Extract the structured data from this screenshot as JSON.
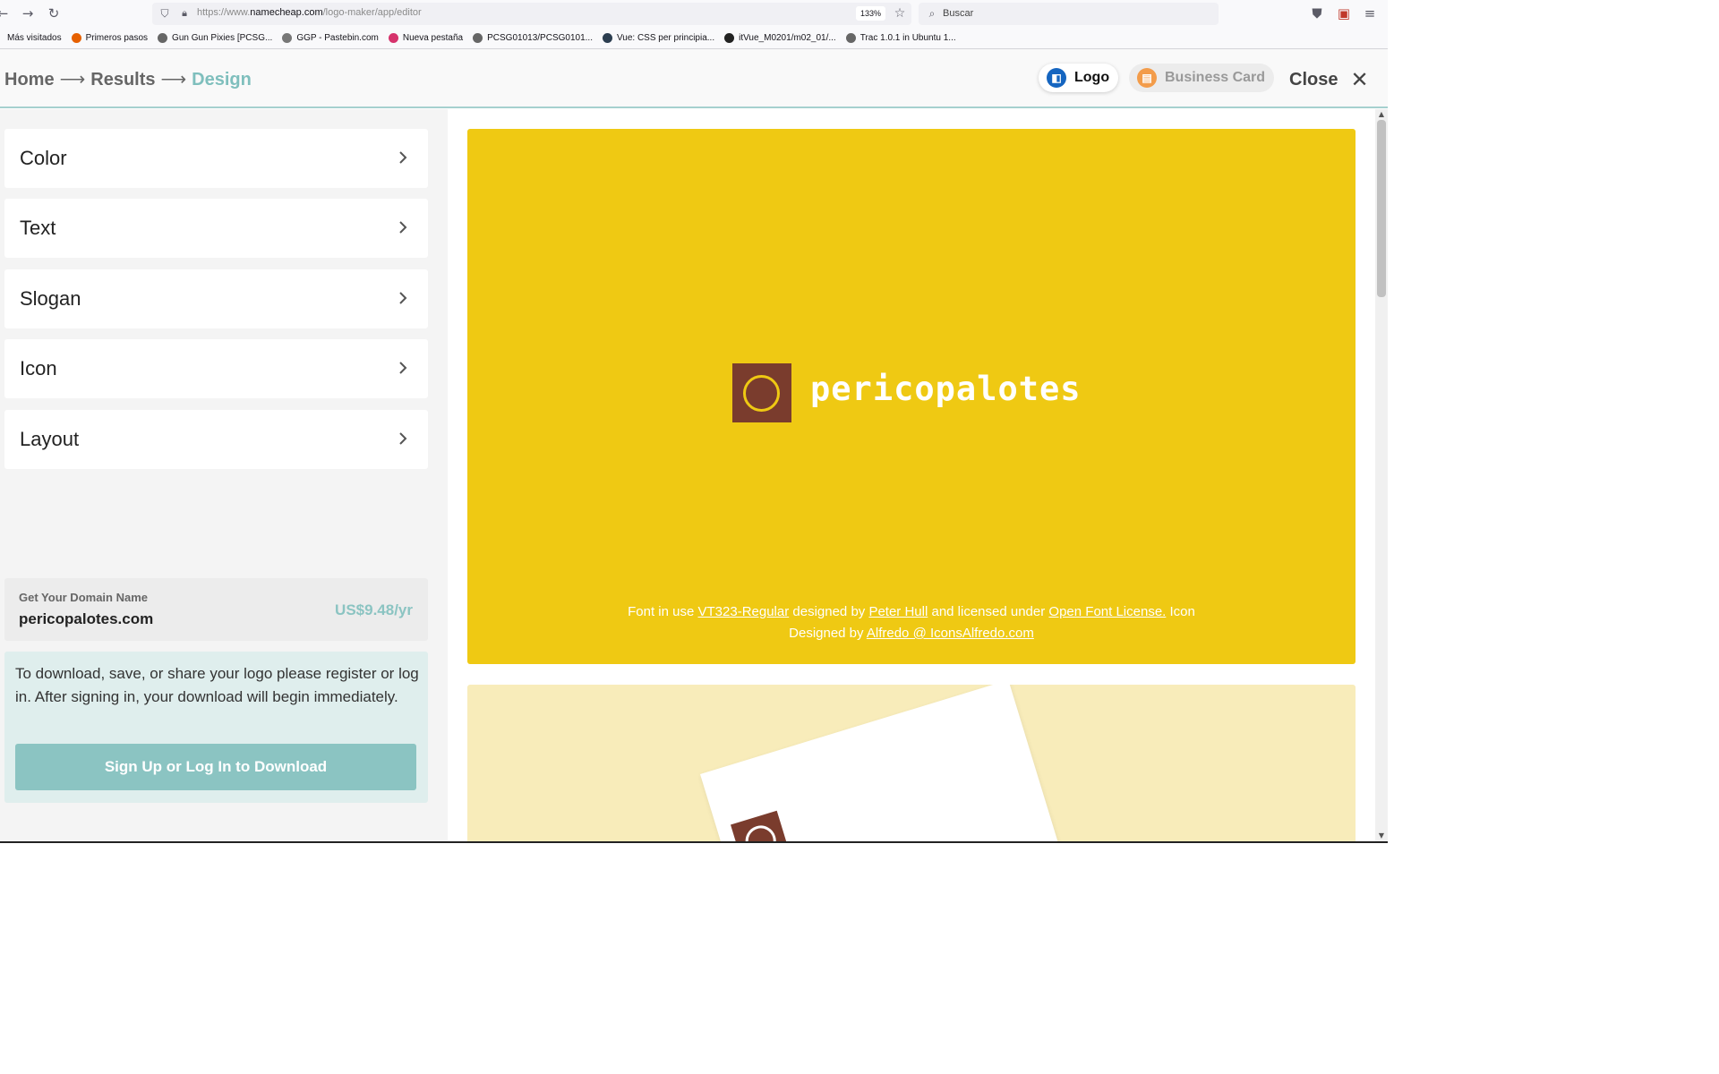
{
  "browser": {
    "url_prefix": "https://www.",
    "url_domain": "namecheap.com",
    "url_path": "/logo-maker/app/editor",
    "zoom": "133%",
    "search_placeholder": "Buscar",
    "bookmarks": [
      {
        "label": "Más visitados",
        "icon": "star-icon",
        "color": "#555555"
      },
      {
        "label": "Primeros pasos",
        "icon": "firefox-icon",
        "color": "#e66000"
      },
      {
        "label": "Gun Gun Pixies [PCSG...",
        "icon": "globe-icon",
        "color": "#666666"
      },
      {
        "label": "GGP - Pastebin.com",
        "icon": "pastebin-icon",
        "color": "#777777"
      },
      {
        "label": "Nueva pestaña",
        "icon": "firefox-icon",
        "color": "#d6336c"
      },
      {
        "label": "PCSG01013/PCSG0101...",
        "icon": "globe-icon",
        "color": "#666666"
      },
      {
        "label": "Vue: CSS per principia...",
        "icon": "vue-icon",
        "color": "#2c3e50"
      },
      {
        "label": "itVue_M0201/m02_01/...",
        "icon": "github-icon",
        "color": "#222222"
      },
      {
        "label": "Trac 1.0.1 in Ubuntu 1...",
        "icon": "globe-icon",
        "color": "#666666"
      }
    ]
  },
  "header": {
    "crumbs": [
      "Home",
      "Results",
      "Design"
    ],
    "crumb_sep": "⟶",
    "tab_logo": "Logo",
    "tab_card": "Business Card",
    "close_label": "Close",
    "accent": "#7fbfbd"
  },
  "sidebar": {
    "items": [
      {
        "label": "Color"
      },
      {
        "label": "Text"
      },
      {
        "label": "Slogan"
      },
      {
        "label": "Icon"
      },
      {
        "label": "Layout"
      }
    ],
    "domain_hint": "Get Your Domain Name",
    "domain_name": "pericopalotes.com",
    "domain_price": "US$9.48/yr",
    "info_text": "To download, save, or share your logo please register or log in. After signing in, your download will begin immediately.",
    "cta_label": "Sign Up or Log In to Download"
  },
  "preview": {
    "brand_name": "pericopalotes",
    "bg_color": "#efc913",
    "mark_color": "#7a3c2d",
    "credits": {
      "p1": "Font in use ",
      "font_link": "VT323-Regular",
      "p2": " designed by ",
      "author_link": "Peter Hull",
      "p3": " and licensed under ",
      "license_link": "Open Font License.",
      "p4": " Icon",
      "p5": "Designed by ",
      "icon_link": "Alfredo @ IconsAlfredo.com"
    }
  }
}
